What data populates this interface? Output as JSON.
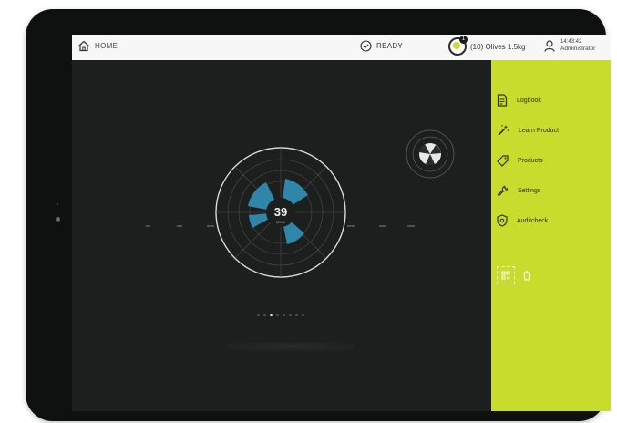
{
  "topbar": {
    "home_label": "HOME",
    "status_label": "READY",
    "product_label": "(10) Olives 1.5kg",
    "product_badge": "1",
    "time": "14:43:42",
    "user": "Administrator"
  },
  "sidebar": {
    "items": [
      {
        "label": "Logbook",
        "icon": "logbook-icon"
      },
      {
        "label": "Learn Product",
        "icon": "magic-wand-icon"
      },
      {
        "label": "Products",
        "icon": "tag-icon"
      },
      {
        "label": "Settings",
        "icon": "wrench-icon"
      },
      {
        "label": "Auditcheck",
        "icon": "shield-icon"
      }
    ],
    "tools": [
      "select-all-icon",
      "trash-icon"
    ]
  },
  "gauge": {
    "value": "39",
    "unit": "MMM"
  },
  "pager": {
    "count": 8,
    "active": 2
  },
  "colors": {
    "accent": "#c8dc2e",
    "gauge_fill": "#2f86a8",
    "screen": "#1d1e1e",
    "topbar": "#f7f7f7"
  }
}
